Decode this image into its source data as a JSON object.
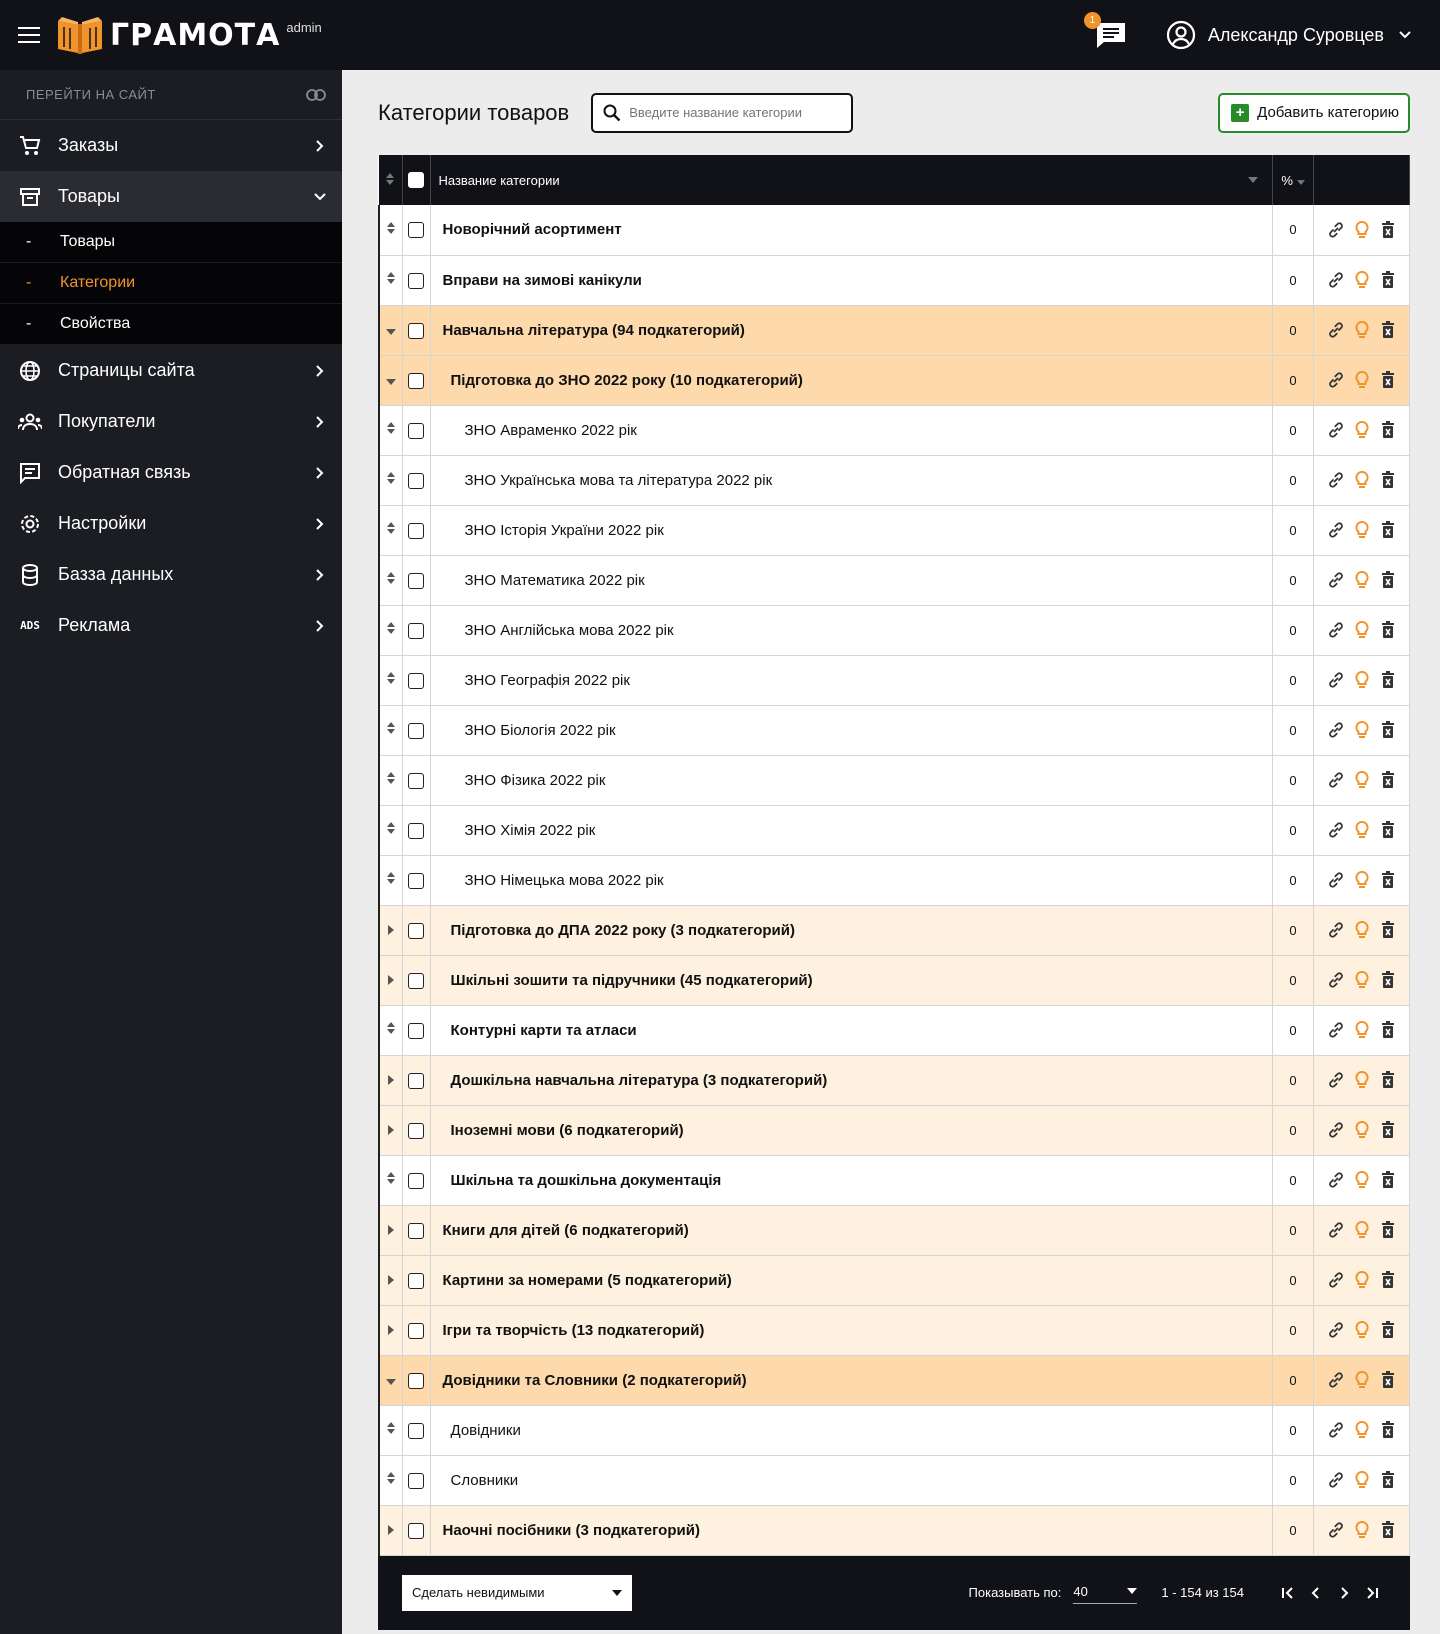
{
  "brand": {
    "name": "ГРАМОТА",
    "sub": "admin"
  },
  "sidebar": {
    "goto_site": "ПЕРЕЙТИ НА САЙТ",
    "items": [
      {
        "label": "Заказы",
        "icon": "cart-icon"
      },
      {
        "label": "Товары",
        "icon": "archive-icon",
        "expanded": true
      },
      {
        "label": "Страницы сайта",
        "icon": "globe-icon"
      },
      {
        "label": "Покупатели",
        "icon": "users-icon"
      },
      {
        "label": "Обратная связь",
        "icon": "message-icon"
      },
      {
        "label": "Настройки",
        "icon": "gear-icon"
      },
      {
        "label": "Базза данных",
        "icon": "database-icon"
      },
      {
        "label": "Реклама",
        "icon": "ads-icon"
      }
    ],
    "sub_items": [
      {
        "label": "Товары",
        "current": false
      },
      {
        "label": "Категории",
        "current": true
      },
      {
        "label": "Свойства",
        "current": false
      }
    ],
    "sub_dash": "-",
    "ads_text": "ADS"
  },
  "topbar": {
    "notifications": "1",
    "user_name": "Александр Суровцев"
  },
  "page": {
    "title": "Категории товаров",
    "search_placeholder": "Введите название категории",
    "add_label": "Добавить категорию"
  },
  "table": {
    "col_name": "Название категории",
    "col_percent": "%",
    "rows": [
      {
        "name": "Новорічний асортимент",
        "pct": "0",
        "state": "leaf",
        "level": 0,
        "bold": true
      },
      {
        "name": "Вправи на зимові канікули",
        "pct": "0",
        "state": "leaf",
        "level": 0,
        "bold": true
      },
      {
        "name": "Навчальна література (94 подкатегорий)",
        "pct": "0",
        "state": "exp",
        "level": 0,
        "bold": true
      },
      {
        "name": "Підготовка до ЗНО 2022 року (10 подкатегорий)",
        "pct": "0",
        "state": "exp",
        "level": 1,
        "bold": true
      },
      {
        "name": "ЗНО Авраменко 2022 рік",
        "pct": "0",
        "state": "leaf",
        "level": 2,
        "bold": false
      },
      {
        "name": "ЗНО Українська мова та література 2022 рік",
        "pct": "0",
        "state": "leaf",
        "level": 2,
        "bold": false
      },
      {
        "name": "ЗНО Історія України 2022 рік",
        "pct": "0",
        "state": "leaf",
        "level": 2,
        "bold": false
      },
      {
        "name": "ЗНО Математика 2022 рік",
        "pct": "0",
        "state": "leaf",
        "level": 2,
        "bold": false
      },
      {
        "name": "ЗНО Англійська мова 2022 рік",
        "pct": "0",
        "state": "leaf",
        "level": 2,
        "bold": false
      },
      {
        "name": "ЗНО Географія 2022 рік",
        "pct": "0",
        "state": "leaf",
        "level": 2,
        "bold": false
      },
      {
        "name": "ЗНО Біологія 2022 рік",
        "pct": "0",
        "state": "leaf",
        "level": 2,
        "bold": false
      },
      {
        "name": "ЗНО Фізика 2022 рік",
        "pct": "0",
        "state": "leaf",
        "level": 2,
        "bold": false
      },
      {
        "name": "ЗНО Хімія 2022 рік",
        "pct": "0",
        "state": "leaf",
        "level": 2,
        "bold": false
      },
      {
        "name": "ЗНО Німецька мова 2022 рік",
        "pct": "0",
        "state": "leaf",
        "level": 2,
        "bold": false
      },
      {
        "name": "Підготовка до ДПА 2022 року (3 подкатегорий)",
        "pct": "0",
        "state": "col",
        "level": 1,
        "bold": true
      },
      {
        "name": "Шкільні зошити та підручники (45 подкатегорий)",
        "pct": "0",
        "state": "col",
        "level": 1,
        "bold": true
      },
      {
        "name": "Контурні карти та атласи",
        "pct": "0",
        "state": "leaf",
        "level": 1,
        "bold": true
      },
      {
        "name": "Дошкільна навчальна література (3 подкатегорий)",
        "pct": "0",
        "state": "col",
        "level": 1,
        "bold": true
      },
      {
        "name": "Іноземні мови (6 подкатегорий)",
        "pct": "0",
        "state": "col",
        "level": 1,
        "bold": true
      },
      {
        "name": "Шкільна та дошкільна документація",
        "pct": "0",
        "state": "leaf",
        "level": 1,
        "bold": true
      },
      {
        "name": "Книги для дітей (6 подкатегорий)",
        "pct": "0",
        "state": "col",
        "level": 0,
        "bold": true
      },
      {
        "name": "Картини за номерами (5 подкатегорий)",
        "pct": "0",
        "state": "col",
        "level": 0,
        "bold": true
      },
      {
        "name": "Ігри та творчість (13 подкатегорий)",
        "pct": "0",
        "state": "col",
        "level": 0,
        "bold": true
      },
      {
        "name": "Довідники та Словники (2 подкатегорий)",
        "pct": "0",
        "state": "exp",
        "level": 0,
        "bold": true
      },
      {
        "name": "Довідники",
        "pct": "0",
        "state": "leaf",
        "level": 1,
        "bold": false
      },
      {
        "name": "Словники",
        "pct": "0",
        "state": "leaf",
        "level": 1,
        "bold": false
      },
      {
        "name": "Наочні посібники (3 подкатегорий)",
        "pct": "0",
        "state": "col",
        "level": 0,
        "bold": true
      }
    ]
  },
  "footer": {
    "bulk_action": "Сделать невидимыми",
    "per_page_label": "Показывать по:",
    "per_page": "40",
    "range": "1 - 154 из 154"
  },
  "colors": {
    "accent": "#f0932b",
    "sidebar": "#1b1d22",
    "expanded_row": "#fdd9ab",
    "collapsed_row": "#fff1df",
    "add_green": "#2a8a2a"
  }
}
